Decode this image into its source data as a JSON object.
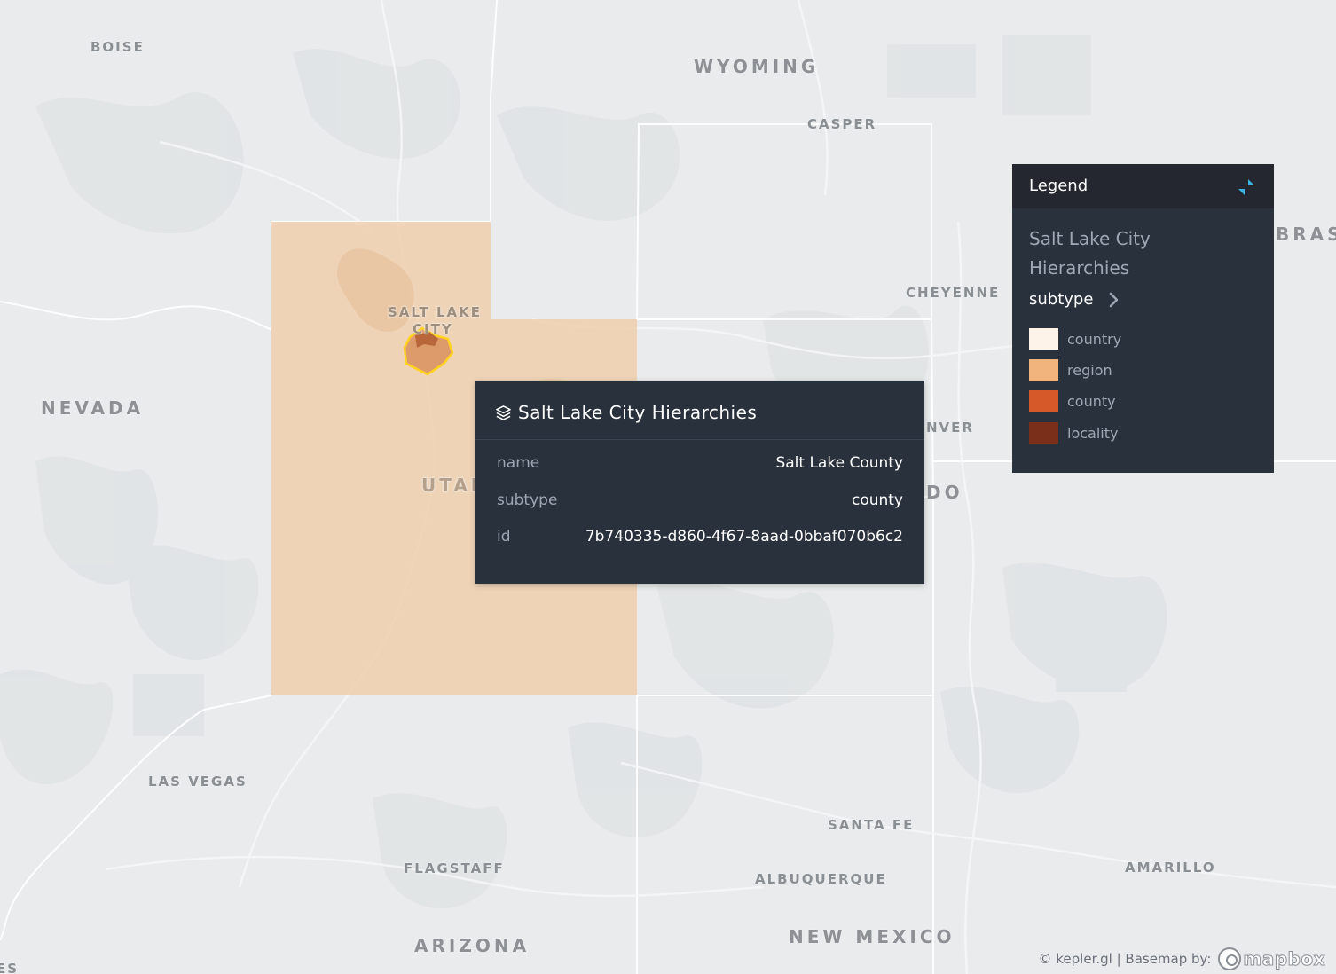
{
  "map": {
    "place_labels": {
      "boise": "BOISE",
      "wyoming": "WYOMING",
      "casper": "CASPER",
      "brasl": "BRASI",
      "cheyenne": "CHEYENNE",
      "nevada": "NEVADA",
      "salt_lake_city_line1": "SALT LAKE",
      "salt_lake_city_line2": "CITY",
      "utah": "UTAH",
      "denver_partial": "NVER",
      "colorado_partial": "DO",
      "las_vegas": "LAS VEGAS",
      "santa_fe": "SANTA FE",
      "flagstaff": "FLAGSTAFF",
      "albuquerque": "ALBUQUERQUE",
      "amarillo": "AMARILLO",
      "arizona": "ARIZONA",
      "new_mexico": "NEW MEXICO",
      "edge_fragment": "ES"
    },
    "colors": {
      "background": "#e9ebec",
      "region_fill": "#efcca7",
      "county_fill": "#dd9a6b",
      "locality_fill": "#b8673a",
      "highlight_stroke": "#ffd21e"
    }
  },
  "tooltip": {
    "icon": "layers-icon",
    "title": "Salt Lake City Hierarchies",
    "rows": [
      {
        "key": "name",
        "value": "Salt Lake County"
      },
      {
        "key": "subtype",
        "value": "county"
      },
      {
        "key": "id",
        "value": "7b740335-d860-4f67-8aad-0bbaf070b6c2"
      }
    ]
  },
  "legend": {
    "title": "Legend",
    "collapse_icon": "collapse-icon",
    "layer_name": "Salt Lake City Hierarchies",
    "field_name": "subtype",
    "items": [
      {
        "label": "country",
        "color": "#fdf3e8"
      },
      {
        "label": "region",
        "color": "#f1b47c"
      },
      {
        "label": "county",
        "color": "#d6592a"
      },
      {
        "label": "locality",
        "color": "#7a2f1a"
      }
    ]
  },
  "attribution": {
    "text": "© kepler.gl | Basemap by:",
    "provider": "mapbox"
  }
}
